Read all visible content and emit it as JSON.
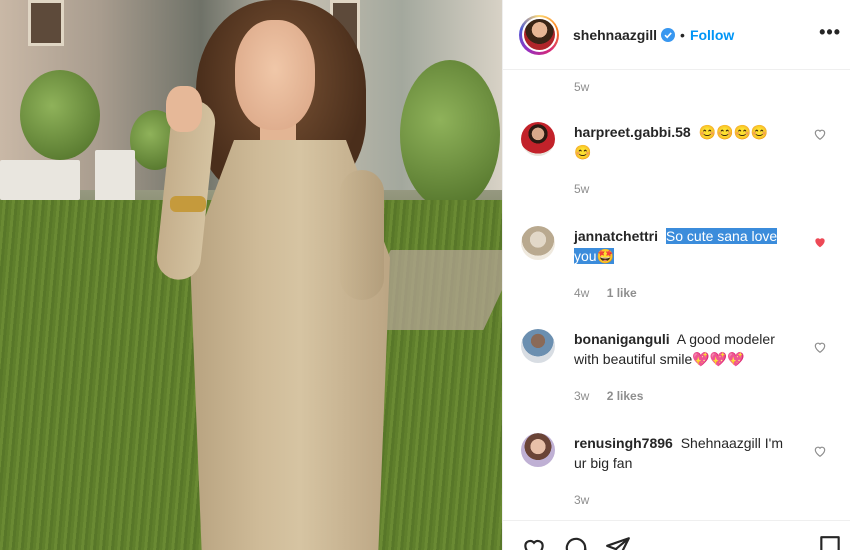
{
  "post": {
    "username": "shehnaazgill",
    "verified": true,
    "separator": "•",
    "follow_label": "Follow",
    "more_label": "•••",
    "post_time": "5w"
  },
  "comments": [
    {
      "username": "harpreet.gabbi.58",
      "text_line1": "😊😊😊😊",
      "text_line2": "😊",
      "time": "5w",
      "likes": "",
      "liked": false
    },
    {
      "username": "jannatchettri",
      "text_sel1": "So cute sana love",
      "text_sel2": "you🤩",
      "time": "4w",
      "likes": "1 like",
      "liked": true
    },
    {
      "username": "bonaniganguli",
      "text_line1": "A good modeler",
      "text_line2": "with beautiful smile",
      "emoji": "💖💖💖",
      "time": "3w",
      "likes": "2 likes",
      "liked": false
    },
    {
      "username": "renusingh7896",
      "text_line1": "Shehnaazgill I'm",
      "text_line2": "ur big fan",
      "time": "3w",
      "likes": "",
      "liked": false
    }
  ],
  "colors": {
    "accent": "#0095f6",
    "liked_heart": "#ed4956",
    "selection": "#3b8cdb",
    "meta_text": "#8e8e8e"
  },
  "icons": {
    "like": "heart-icon",
    "comment": "comment-icon",
    "share": "paper-plane-icon",
    "save": "bookmark-icon"
  }
}
